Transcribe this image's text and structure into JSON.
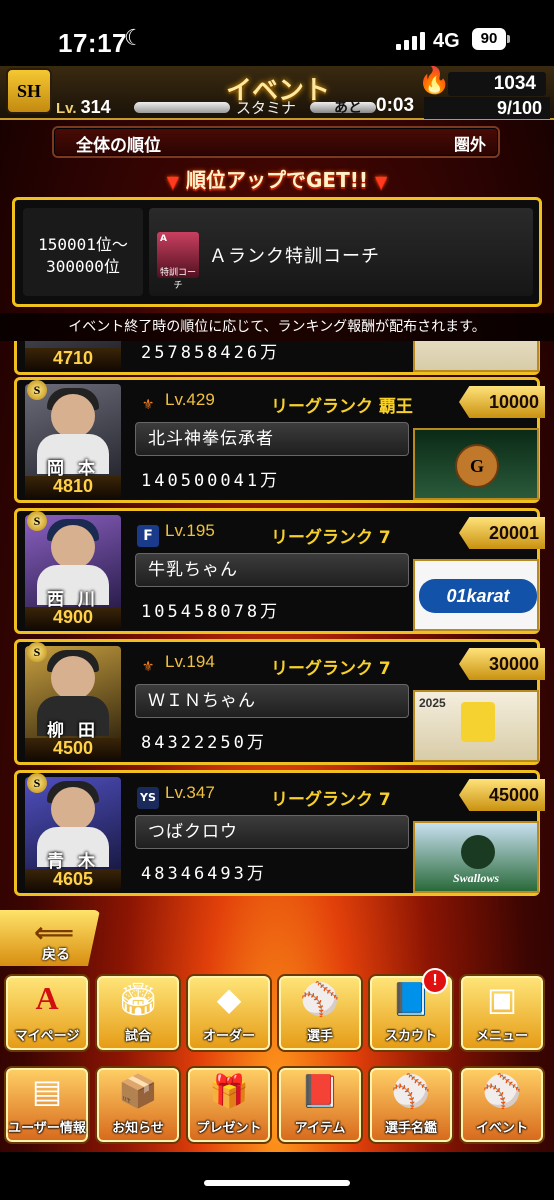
{
  "status_bar": {
    "time": "17:17",
    "network": "4G",
    "battery": "90"
  },
  "header": {
    "logo_text": "SH",
    "title": "イベント",
    "coins": "1034",
    "level_label": "Lv.",
    "level_value": "314",
    "stamina_label": "スタミナ",
    "ato_label": "あと",
    "stamina_timer": "0:03",
    "stamina_count": "9/100"
  },
  "rank_bar": {
    "label": "全体の順位",
    "value": "圏外"
  },
  "rank_up_banner": "順位アップでGET!!",
  "reward": {
    "range_line1": "150001位～",
    "range_line2": "300000位",
    "item_tag": "特訓コーチ",
    "item_rank": "A",
    "item_name": "Ａランク特訓コーチ"
  },
  "notice": "イベント終了時の順位に応じて、ランキング報酬が配布されます。",
  "previous_entry": {
    "rating": "4710",
    "score": "257858426万"
  },
  "entries": [
    {
      "player": "岡 本",
      "rating": "4810",
      "team_icon": "giants-icon",
      "level": "Lv.429",
      "league": "リーグランク 覇王",
      "points": "10000",
      "user": "北斗神拳伝承者",
      "score": "140500041万",
      "banner": "giants-logo",
      "banner_text": "G"
    },
    {
      "player": "西 川",
      "rating": "4900",
      "team_icon": "fighters-icon",
      "level": "Lv.195",
      "league": "リーグランク 7",
      "points": "20001",
      "user": "牛乳ちゃん",
      "score": "105458078万",
      "banner": "ichikara-logo",
      "banner_text": "01karat"
    },
    {
      "player": "柳 田",
      "rating": "4500",
      "team_icon": "hawks-icon",
      "level": "Lv.194",
      "league": "リーグランク 7",
      "points": "30000",
      "user": "ＷＩＮちゃん",
      "score": "84322250万",
      "banner": "new-year-2025",
      "banner_text": "2025"
    },
    {
      "player": "青 木",
      "rating": "4605",
      "team_icon": "swallows-icon",
      "level": "Lv.347",
      "league": "リーグランク 7",
      "points": "45000",
      "user": "つばクロウ",
      "score": "48346493万",
      "banner": "swallows-logo",
      "banner_text": "Swallows"
    }
  ],
  "back_button": "戻る",
  "nav_row1": [
    {
      "label": "マイページ",
      "icon": "mypage-icon"
    },
    {
      "label": "試合",
      "icon": "stadium-icon"
    },
    {
      "label": "オーダー",
      "icon": "field-order-icon"
    },
    {
      "label": "選手",
      "icon": "player-icon"
    },
    {
      "label": "スカウト",
      "icon": "scout-icon"
    },
    {
      "label": "メニュー",
      "icon": "menu-icon"
    }
  ],
  "nav_row2": [
    {
      "label": "ユーザー情報",
      "icon": "user-info-icon"
    },
    {
      "label": "お知らせ",
      "icon": "news-icon"
    },
    {
      "label": "プレゼント",
      "icon": "gift-icon"
    },
    {
      "label": "アイテム",
      "icon": "item-icon"
    },
    {
      "label": "選手名鑑",
      "icon": "player-book-icon"
    },
    {
      "label": "イベント",
      "icon": "event-icon"
    }
  ],
  "scout_alert": "!",
  "colors": {
    "gold": "#f0c020",
    "header_text": "#ffe9a0",
    "alert": "#e01010"
  }
}
